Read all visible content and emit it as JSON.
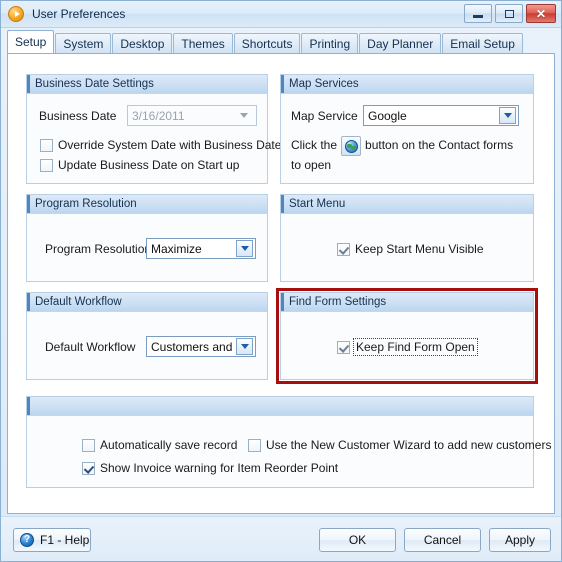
{
  "window": {
    "title": "User Preferences",
    "app_icon": "play-circle-icon",
    "buttons": {
      "minimize": "minimize-icon",
      "maximize": "maximize-icon",
      "close": "close-icon"
    }
  },
  "tabs": [
    {
      "label": "Setup",
      "active": true
    },
    {
      "label": "System",
      "active": false
    },
    {
      "label": "Desktop",
      "active": false
    },
    {
      "label": "Themes",
      "active": false
    },
    {
      "label": "Shortcuts",
      "active": false
    },
    {
      "label": "Printing",
      "active": false
    },
    {
      "label": "Day Planner",
      "active": false
    },
    {
      "label": "Email Setup",
      "active": false
    }
  ],
  "groups": {
    "business_date": {
      "title": "Business Date Settings",
      "date_label": "Business Date",
      "date_value": "3/16/2011",
      "override_label": "Override System Date with Business Date",
      "update_label": "Update Business Date on Start up"
    },
    "map_services": {
      "title": "Map Services",
      "service_label": "Map Service",
      "service_value": "Google",
      "hint_before": "Click the",
      "hint_icon": "globe-icon",
      "hint_after": "button on the Contact forms to open"
    },
    "program_resolution": {
      "title": "Program Resolution",
      "label": "Program Resolution",
      "value": "Maximize"
    },
    "start_menu": {
      "title": "Start Menu",
      "keep_visible_label": "Keep Start Menu Visible"
    },
    "default_workflow": {
      "title": "Default Workflow",
      "label": "Default Workflow",
      "value": "Customers and Sales"
    },
    "find_form": {
      "title": "Find Form Settings",
      "keep_open_label": "Keep Find Form Open"
    },
    "misc": {
      "title": "",
      "auto_save_label": "Automatically save record",
      "wizard_label": "Use the New Customer Wizard to add new customers",
      "reorder_label": "Show Invoice warning for Item Reorder Point"
    }
  },
  "footer": {
    "help_label": "F1 - Help",
    "help_icon": "question-circle-icon",
    "ok_label": "OK",
    "cancel_label": "Cancel",
    "apply_label": "Apply"
  },
  "colors": {
    "highlight": "#a70f0f",
    "accent": "#4f86c0",
    "titlebar": "#dceaf8"
  }
}
